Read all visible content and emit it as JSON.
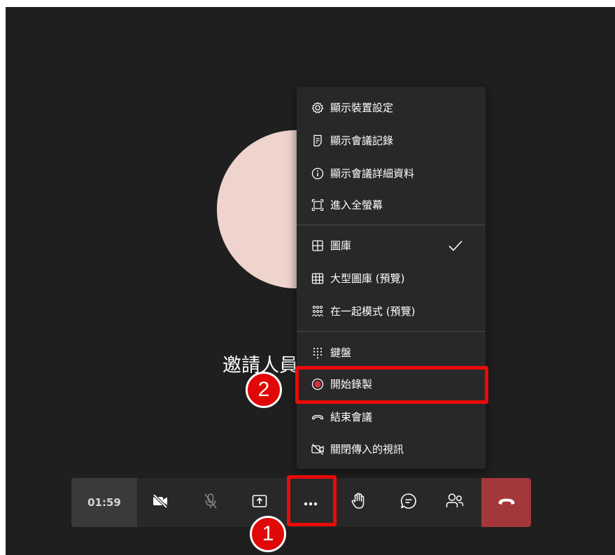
{
  "stage": {
    "invite_text": "邀請人員"
  },
  "menu": {
    "items": [
      {
        "label": "顯示裝置設定",
        "icon": "gear-icon"
      },
      {
        "label": "顯示會議記錄",
        "icon": "notes-icon"
      },
      {
        "label": "顯示會議詳細資料",
        "icon": "info-icon"
      },
      {
        "label": "進入全螢幕",
        "icon": "fullscreen-icon"
      },
      {
        "label": "圖庫",
        "icon": "gallery-icon",
        "checked": true
      },
      {
        "label": "大型圖庫 (預覽)",
        "icon": "large-gallery-icon"
      },
      {
        "label": "在一起模式 (預覽)",
        "icon": "together-mode-icon"
      },
      {
        "label": "鍵盤",
        "icon": "keypad-icon"
      },
      {
        "label": "開始錄製",
        "icon": "record-icon"
      },
      {
        "label": "結束會議",
        "icon": "end-meeting-icon"
      },
      {
        "label": "關閉傳入的視訊",
        "icon": "video-off-icon"
      }
    ]
  },
  "toolbar": {
    "timer": "01:59",
    "buttons": [
      "camera-off-icon",
      "mic-off-icon",
      "share-screen-icon",
      "more-options-icon",
      "raise-hand-icon",
      "chat-icon",
      "participants-icon"
    ],
    "hangup_icon": "hang-up-icon"
  },
  "annotations": {
    "step1": "1",
    "step2": "2",
    "highlight_color": "#ea0a0a"
  },
  "colors": {
    "background": "#201f1f",
    "menu": "#292828",
    "hangup": "#a4373a",
    "record": "#d13438",
    "avatar": "#efd3cd"
  }
}
